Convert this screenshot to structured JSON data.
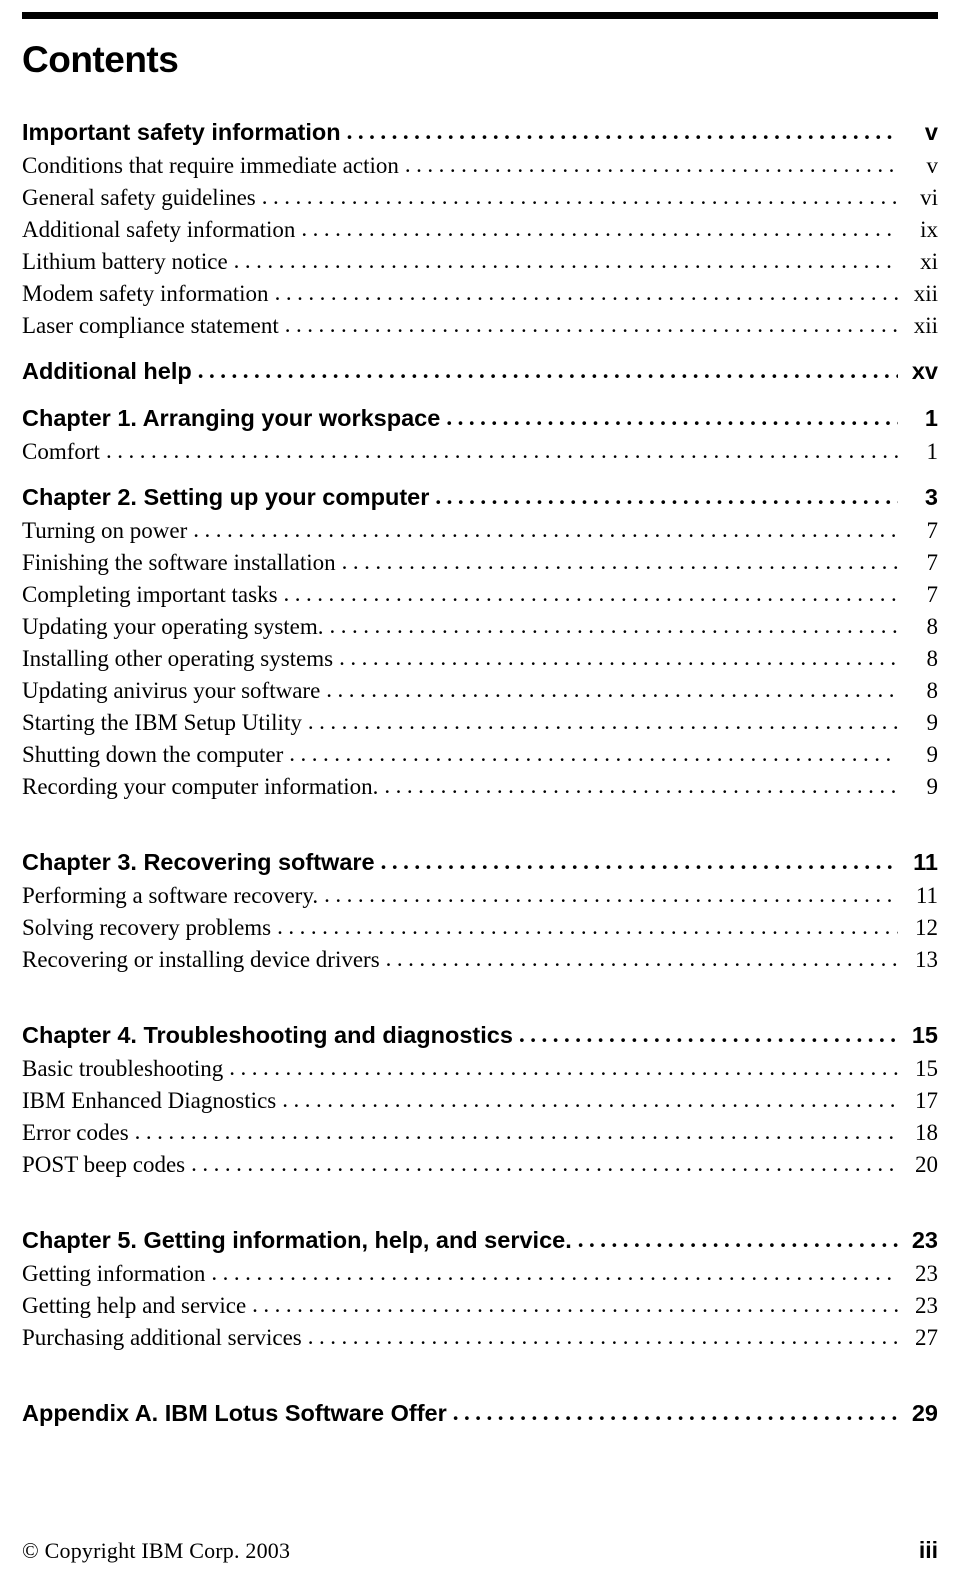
{
  "page": {
    "title": "Contents",
    "footer": {
      "copyright": "© Copyright IBM Corp. 2003",
      "folio": "iii"
    }
  },
  "toc": {
    "entries": [
      {
        "label": "Important safety information",
        "page": "v",
        "bold": true,
        "space_before": "none"
      },
      {
        "label": "Conditions that require immediate action",
        "page": "v",
        "bold": false,
        "space_before": "none"
      },
      {
        "label": "General safety guidelines",
        "page": "vi",
        "bold": false,
        "space_before": "none"
      },
      {
        "label": "Additional safety information",
        "page": "ix",
        "bold": false,
        "space_before": "none"
      },
      {
        "label": "Lithium battery notice",
        "page": "xi",
        "bold": false,
        "space_before": "none"
      },
      {
        "label": "Modem safety information",
        "page": "xii",
        "bold": false,
        "space_before": "none"
      },
      {
        "label": "Laser compliance statement",
        "page": "xii",
        "bold": false,
        "space_before": "none"
      },
      {
        "label": "Additional help",
        "page": "xv",
        "bold": true,
        "space_before": "sm"
      },
      {
        "label": "Chapter 1. Arranging your workspace",
        "page": "1",
        "bold": true,
        "space_before": "sm"
      },
      {
        "label": "Comfort",
        "page": "1",
        "bold": false,
        "space_before": "none"
      },
      {
        "label": "Chapter 2. Setting up your computer",
        "page": "3",
        "bold": true,
        "space_before": "sm"
      },
      {
        "label": "Turning on power",
        "page": "7",
        "bold": false,
        "space_before": "none"
      },
      {
        "label": "Finishing the software installation",
        "page": "7",
        "bold": false,
        "space_before": "none"
      },
      {
        "label": "Completing important tasks",
        "page": "7",
        "bold": false,
        "space_before": "none"
      },
      {
        "label": "Updating your operating system.",
        "page": "8",
        "bold": false,
        "space_before": "none"
      },
      {
        "label": "Installing other operating systems",
        "page": "8",
        "bold": false,
        "space_before": "none"
      },
      {
        "label": "Updating anivirus your software",
        "page": "8",
        "bold": false,
        "space_before": "none"
      },
      {
        "label": "Starting the IBM Setup Utility",
        "page": "9",
        "bold": false,
        "space_before": "none"
      },
      {
        "label": "Shutting down the computer",
        "page": "9",
        "bold": false,
        "space_before": "none"
      },
      {
        "label": "Recording your computer information.",
        "page": "9",
        "bold": false,
        "space_before": "none"
      },
      {
        "label": "Chapter 3. Recovering software",
        "page": "11",
        "bold": true,
        "space_before": "lg"
      },
      {
        "label": "Performing a software recovery.",
        "page": "11",
        "bold": false,
        "space_before": "none"
      },
      {
        "label": "Solving recovery problems",
        "page": "12",
        "bold": false,
        "space_before": "none"
      },
      {
        "label": "Recovering or installing device drivers",
        "page": "13",
        "bold": false,
        "space_before": "none"
      },
      {
        "label": "Chapter 4. Troubleshooting and diagnostics",
        "page": "15",
        "bold": true,
        "space_before": "lg"
      },
      {
        "label": "Basic troubleshooting",
        "page": "15",
        "bold": false,
        "space_before": "none"
      },
      {
        "label": "IBM Enhanced Diagnostics",
        "page": "17",
        "bold": false,
        "space_before": "none"
      },
      {
        "label": "Error codes",
        "page": "18",
        "bold": false,
        "space_before": "none"
      },
      {
        "label": "POST beep codes",
        "page": "20",
        "bold": false,
        "space_before": "none"
      },
      {
        "label": "Chapter 5. Getting information, help, and service.",
        "page": "23",
        "bold": true,
        "space_before": "lg"
      },
      {
        "label": "Getting information",
        "page": "23",
        "bold": false,
        "space_before": "none"
      },
      {
        "label": "Getting help and service",
        "page": "23",
        "bold": false,
        "space_before": "none"
      },
      {
        "label": "Purchasing additional services",
        "page": "27",
        "bold": false,
        "space_before": "none"
      },
      {
        "label": "Appendix A. IBM Lotus Software Offer",
        "page": "29",
        "bold": true,
        "space_before": "lg"
      }
    ]
  }
}
